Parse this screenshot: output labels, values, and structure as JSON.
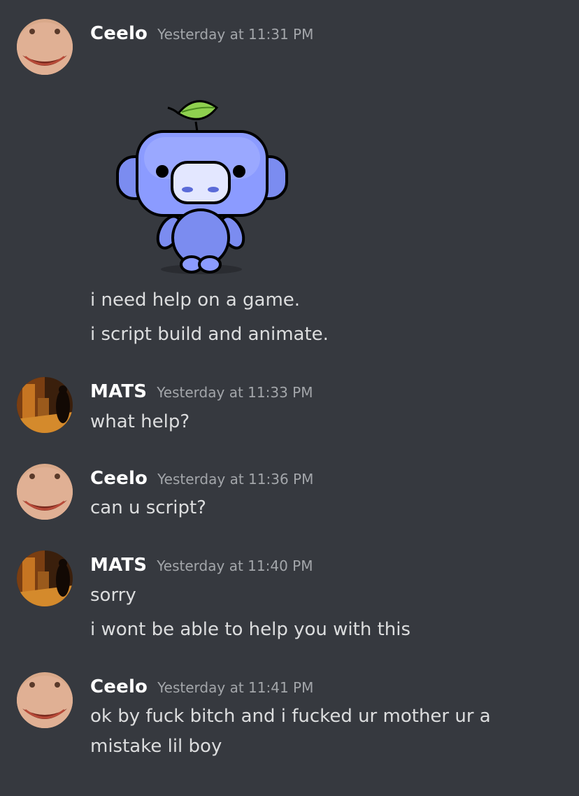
{
  "messages": [
    {
      "author": "Ceelo",
      "timestamp": "Yesterday at 11:31 PM",
      "sticker": "wumpus-sprout-sticker",
      "lines": [
        "i need help on a game.",
        "i script build and animate."
      ]
    },
    {
      "author": "MATS",
      "timestamp": "Yesterday at 11:33 PM",
      "lines": [
        "what help?"
      ]
    },
    {
      "author": "Ceelo",
      "timestamp": "Yesterday at 11:36 PM",
      "lines": [
        "can u script?"
      ]
    },
    {
      "author": "MATS",
      "timestamp": "Yesterday at 11:40 PM",
      "lines": [
        "sorry",
        "i wont be able to help you with this"
      ]
    },
    {
      "author": "Ceelo",
      "timestamp": "Yesterday at 11:41 PM",
      "lines": [
        "ok by fuck bitch and i fucked ur mother ur a mistake lil boy"
      ]
    }
  ],
  "colors": {
    "background": "#36393f",
    "username": "#ffffff",
    "timestamp": "#a3a6aa",
    "message_text": "#dcddde",
    "wumpus_blue": "#7b8cf0"
  }
}
